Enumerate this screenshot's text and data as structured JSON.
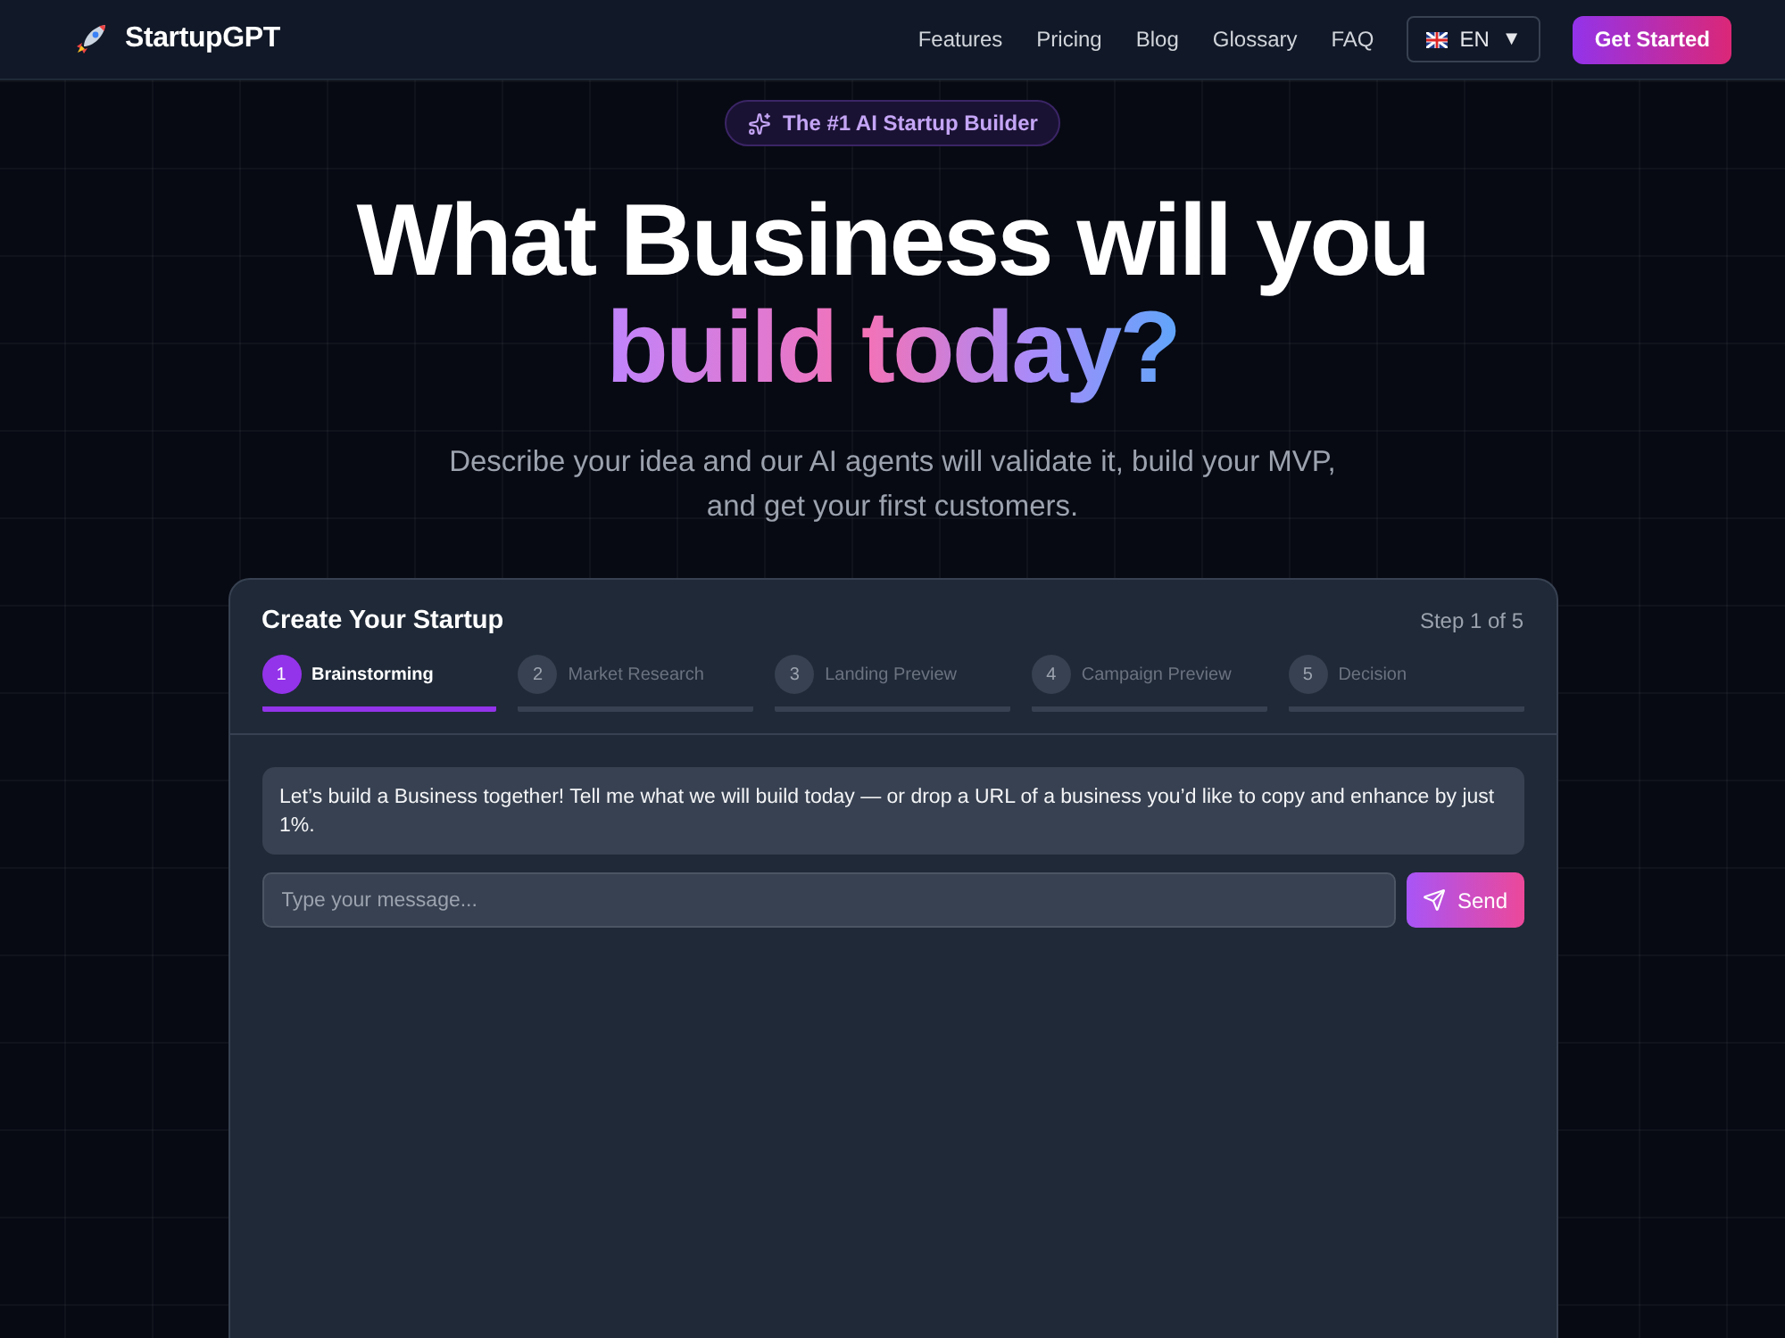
{
  "nav": {
    "logo_text": "StartupGPT",
    "links": [
      "Features",
      "Pricing",
      "Blog",
      "Glossary",
      "FAQ"
    ],
    "language": {
      "code": "EN",
      "caret": "▼"
    },
    "cta": "Get Started"
  },
  "hero": {
    "badge": "The #1 AI Startup Builder",
    "headline": "What Business will you",
    "headline_highlight": "build today?",
    "subtitle": "Describe your idea and our AI agents will validate it, build your MVP, and get your first customers."
  },
  "card": {
    "title": "Create Your Startup",
    "step_counter": "Step 1 of 5",
    "steps": [
      {
        "number": "1",
        "label": "Brainstorming",
        "selected": true
      },
      {
        "number": "2",
        "label": "Market Research",
        "selected": false
      },
      {
        "number": "3",
        "label": "Landing Preview",
        "selected": false
      },
      {
        "number": "4",
        "label": "Campaign Preview",
        "selected": false
      },
      {
        "number": "5",
        "label": "Decision",
        "selected": false
      }
    ],
    "messages": [
      {
        "text": "Let’s build a Business together! Tell me what we will build today — or drop a URL of a business you’d like to copy and enhance by just 1%."
      }
    ],
    "input": {
      "placeholder": "Type your message..."
    },
    "send_button": "Send"
  }
}
